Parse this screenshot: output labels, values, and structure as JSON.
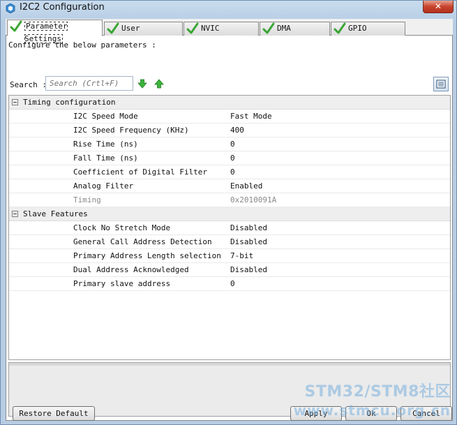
{
  "window": {
    "title": "I2C2 Configuration",
    "close_label": "✕"
  },
  "tabs": [
    {
      "label": "Parameter Settings",
      "active": true
    },
    {
      "label": "User Constants",
      "active": false
    },
    {
      "label": "NVIC Settings",
      "active": false
    },
    {
      "label": "DMA Settings",
      "active": false
    },
    {
      "label": "GPIO Settings",
      "active": false
    }
  ],
  "panel": {
    "instruction": "Configure the below parameters :",
    "search_label": "Search :",
    "search_placeholder": "Search (Crtl+F)"
  },
  "groups": [
    {
      "label": "Timing configuration",
      "rows": [
        {
          "name": "I2C Speed Mode",
          "value": "Fast Mode"
        },
        {
          "name": "I2C Speed Frequency (KHz)",
          "value": "400"
        },
        {
          "name": "Rise Time (ns)",
          "value": "0"
        },
        {
          "name": "Fall Time (ns)",
          "value": "0"
        },
        {
          "name": "Coefficient of Digital Filter",
          "value": "0"
        },
        {
          "name": "Analog Filter",
          "value": "Enabled"
        },
        {
          "name": "Timing",
          "value": "0x2010091A"
        }
      ]
    },
    {
      "label": "Slave Features",
      "rows": [
        {
          "name": "Clock No Stretch Mode",
          "value": "Disabled"
        },
        {
          "name": "General Call Address Detection",
          "value": "Disabled"
        },
        {
          "name": "Primary Address Length selection",
          "value": "7-bit"
        },
        {
          "name": "Dual Address Acknowledged",
          "value": "Disabled"
        },
        {
          "name": "Primary slave address",
          "value": "0"
        }
      ]
    }
  ],
  "buttons": {
    "restore": "Restore Default",
    "apply": "Apply",
    "ok": "Ok",
    "cancel": "Cancel"
  },
  "watermark": {
    "line1": "STM32/STM8社区",
    "line2": "www.stmcu.org.cn"
  },
  "colors": {
    "check_green": "#3aa534",
    "arrow_green": "#3cb43c"
  }
}
